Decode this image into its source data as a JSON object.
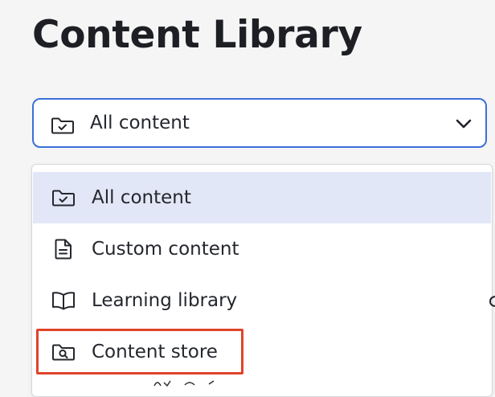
{
  "page": {
    "title": "Content Library"
  },
  "filter": {
    "selected_label": "All content",
    "selected_icon": "folder-check-icon",
    "chevron_icon": "chevron-down-icon",
    "accent_color": "#3b6fd8"
  },
  "menu": {
    "items": [
      {
        "label": "All content",
        "icon": "folder-check-icon",
        "selected": true
      },
      {
        "label": "Custom content",
        "icon": "document-icon",
        "selected": false
      },
      {
        "label": "Learning library",
        "icon": "book-open-icon",
        "selected": false
      },
      {
        "label": "Content store",
        "icon": "folder-search-icon",
        "selected": false,
        "highlighted": true
      }
    ],
    "selected_bg": "#e2e7f7",
    "highlight_color": "#e0442a"
  }
}
